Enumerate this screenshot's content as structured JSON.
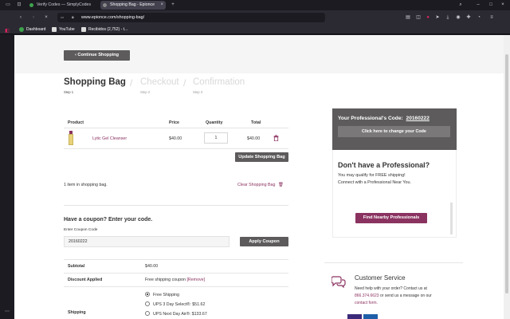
{
  "browser": {
    "tabs": [
      {
        "label": "Verify Codes — SimplyCodes",
        "favicon_color": "#3fa34d"
      },
      {
        "label": "Shopping Bag - Epionce",
        "favicon_color": "#888888"
      }
    ],
    "url": "www.epionce.com/shopping-bag/",
    "bookmarks": [
      {
        "label": "Dashboard",
        "icon_color": "#3fa34d"
      },
      {
        "label": "YouTube",
        "icon_color": "#dddddd"
      },
      {
        "label": "Recibidos (2,752) - t...",
        "icon_color": "#dddddd"
      }
    ]
  },
  "page": {
    "continue_label": "‹ Continue Shopping",
    "steps": [
      {
        "title": "Shopping Bag",
        "sub": "Step 1"
      },
      {
        "title": "Checkout",
        "sub": "Step 2"
      },
      {
        "title": "Confirmation",
        "sub": "Step 3"
      }
    ],
    "cart": {
      "headers": {
        "product": "Product",
        "price": "Price",
        "quantity": "Quantity",
        "total": "Total"
      },
      "items": [
        {
          "name": "Lytic Gel Cleanser",
          "price": "$40.00",
          "quantity": "1",
          "total": "$40.00"
        }
      ],
      "update_label": "Update Shopping Bag",
      "count_text": "1 item in shopping bag.",
      "clear_label": "Clear Shopping Bag"
    },
    "coupon": {
      "heading": "Have a coupon? Enter your code.",
      "field_label": "Enter Coupon Code",
      "value": "20160222",
      "apply_label": "Apply Coupon"
    },
    "summary": {
      "subtotal_label": "Subtotal",
      "subtotal_value": "$40.00",
      "discount_label": "Discount Applied",
      "discount_value": "Free shipping coupon",
      "discount_remove": "[Remove]",
      "shipping_label": "Shipping",
      "shipping_options": [
        {
          "label": "Free Shipping",
          "selected": true
        },
        {
          "label": "UPS 3 Day Select®: $51.62",
          "selected": false
        },
        {
          "label": "UPS Next Day Air®: $133.67",
          "selected": false
        }
      ]
    },
    "professional": {
      "code_label": "Your Professional's Code:",
      "code_value": "20160222",
      "change_label": "Click here to change your Code",
      "no_pro_heading": "Don't have a Professional?",
      "no_pro_line1": "You may qualify for FREE shipping!",
      "no_pro_line2": "Connect with a Professional Near You.",
      "find_label": "Find Nearby Professionals"
    },
    "customer_service": {
      "heading": "Customer Service",
      "line1": "Need help with your order? Contact us at",
      "phone": "866.374.6623",
      "line2_mid": " or send us a message on our",
      "contact_link": "contact form."
    }
  },
  "colors": {
    "brand": "#8b3360",
    "dark_button": "#5d5b5b"
  }
}
